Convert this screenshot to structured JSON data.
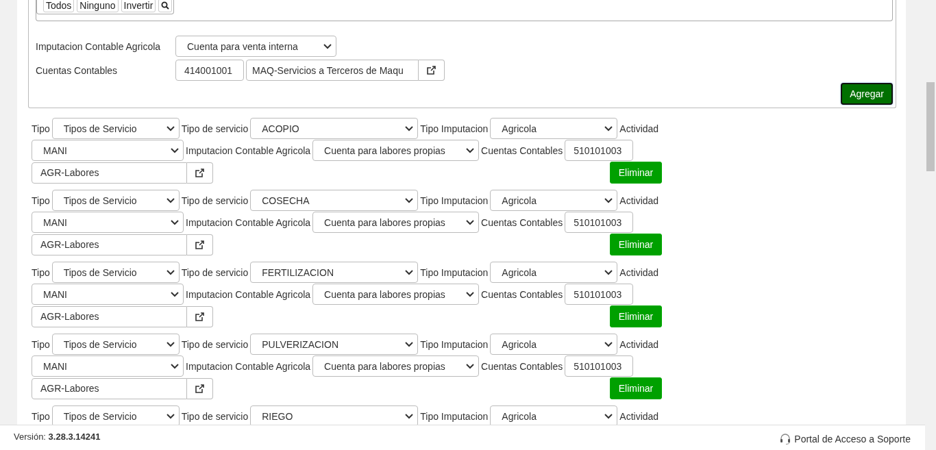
{
  "filter_buttons": [
    "Todos",
    "Ninguno",
    "Invertir"
  ],
  "form": {
    "imputacion_label": "Imputacion Contable Agricola",
    "imputacion_value": "Cuenta para venta interna",
    "cuentas_label": "Cuentas Contables",
    "cuenta_code": "414001001",
    "cuenta_name": "MAQ-Servicios a Terceros de Maqu",
    "add_button": "Agregar"
  },
  "rows": [
    {
      "tipo_label": "Tipo",
      "tipo": "Tipos de Servicio",
      "servicio_label": "Tipo de servicio",
      "servicio": "ACOPIO",
      "imputacion_label": "Tipo Imputacion",
      "imputacion": "Agricola",
      "actividad_label": "Actividad",
      "actividad": "MANI",
      "contable_label": "Imputacion Contable Agricola",
      "contable": "Cuenta para labores propias",
      "cuentas_label": "Cuentas Contables",
      "cuenta_code": "510101003",
      "cuenta_name": "AGR-Labores",
      "delete_button": "Eliminar"
    },
    {
      "tipo_label": "Tipo",
      "tipo": "Tipos de Servicio",
      "servicio_label": "Tipo de servicio",
      "servicio": "COSECHA",
      "imputacion_label": "Tipo Imputacion",
      "imputacion": "Agricola",
      "actividad_label": "Actividad",
      "actividad": "MANI",
      "contable_label": "Imputacion Contable Agricola",
      "contable": "Cuenta para labores propias",
      "cuentas_label": "Cuentas Contables",
      "cuenta_code": "510101003",
      "cuenta_name": "AGR-Labores",
      "delete_button": "Eliminar"
    },
    {
      "tipo_label": "Tipo",
      "tipo": "Tipos de Servicio",
      "servicio_label": "Tipo de servicio",
      "servicio": "FERTILIZACION",
      "imputacion_label": "Tipo Imputacion",
      "imputacion": "Agricola",
      "actividad_label": "Actividad",
      "actividad": "MANI",
      "contable_label": "Imputacion Contable Agricola",
      "contable": "Cuenta para labores propias",
      "cuentas_label": "Cuentas Contables",
      "cuenta_code": "510101003",
      "cuenta_name": "AGR-Labores",
      "delete_button": "Eliminar"
    },
    {
      "tipo_label": "Tipo",
      "tipo": "Tipos de Servicio",
      "servicio_label": "Tipo de servicio",
      "servicio": "PULVERIZACION",
      "imputacion_label": "Tipo Imputacion",
      "imputacion": "Agricola",
      "actividad_label": "Actividad",
      "actividad": "MANI",
      "contable_label": "Imputacion Contable Agricola",
      "contable": "Cuenta para labores propias",
      "cuentas_label": "Cuentas Contables",
      "cuenta_code": "510101003",
      "cuenta_name": "AGR-Labores",
      "delete_button": "Eliminar"
    },
    {
      "tipo_label": "Tipo",
      "tipo": "Tipos de Servicio",
      "servicio_label": "Tipo de servicio",
      "servicio": "RIEGO",
      "imputacion_label": "Tipo Imputacion",
      "imputacion": "Agricola",
      "actividad_label": "Actividad"
    }
  ],
  "footer": {
    "version": "Versión: **3.28.3.14241**",
    "support_link": "Portal de Acceso a Soporte"
  }
}
